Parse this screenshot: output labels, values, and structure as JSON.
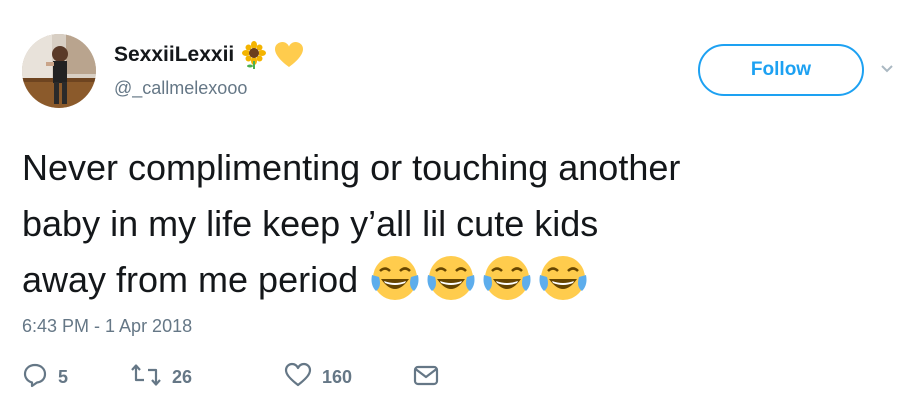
{
  "user": {
    "display_name": "SexxiiLexxii",
    "handle": "@_callmelexooo",
    "name_emojis": [
      "sunflower-icon",
      "yellow-heart-icon"
    ]
  },
  "follow_button": {
    "label": "Follow"
  },
  "tweet": {
    "lines": [
      "Never complimenting or touching another",
      "baby in my life keep y’all lil cute kids",
      "away from me period"
    ],
    "trailing_emojis": [
      "face-with-tears-of-joy-icon",
      "face-with-tears-of-joy-icon",
      "face-with-tears-of-joy-icon",
      "face-with-tears-of-joy-icon"
    ],
    "timestamp": "6:43 PM - 1 Apr 2018"
  },
  "actions": {
    "reply": {
      "icon": "reply-icon",
      "count": "5"
    },
    "retweet": {
      "icon": "retweet-icon",
      "count": "26"
    },
    "like": {
      "icon": "like-icon",
      "count": "160"
    },
    "message": {
      "icon": "direct-message-icon"
    }
  },
  "colors": {
    "brand_blue": "#1da1f2",
    "text_primary": "#14171a",
    "text_secondary": "#657786"
  }
}
